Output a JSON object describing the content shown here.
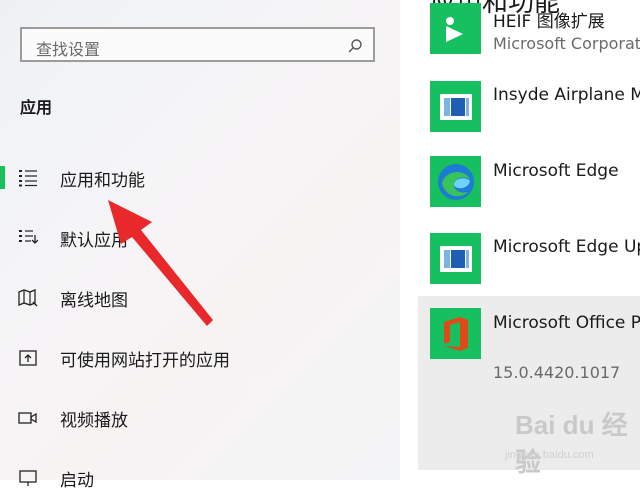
{
  "search": {
    "placeholder": "查找设置",
    "icon": "search-icon"
  },
  "section_title": "应用",
  "nav": [
    {
      "label": "应用和功能",
      "icon": "apps-features-icon",
      "selected": true
    },
    {
      "label": "默认应用",
      "icon": "default-apps-icon"
    },
    {
      "label": "离线地图",
      "icon": "offline-maps-icon"
    },
    {
      "label": "可使用网站打开的应用",
      "icon": "apps-for-websites-icon"
    },
    {
      "label": "视频播放",
      "icon": "video-playback-icon"
    },
    {
      "label": "启动",
      "icon": "startup-icon"
    }
  ],
  "apps_header": "应用和功能",
  "apps": [
    {
      "name": "HEIF 图像扩展",
      "publisher": "Microsoft Corporation"
    },
    {
      "name": "Insyde Airplane Mode",
      "publisher": ""
    },
    {
      "name": "Microsoft Edge",
      "publisher": ""
    },
    {
      "name": "Microsoft Edge Update",
      "publisher": ""
    },
    {
      "name": "Microsoft Office Professional",
      "version": "15.0.4420.1017",
      "selected": true
    }
  ],
  "colors": {
    "accent": "#17c25a",
    "tile_green": "#16c060",
    "office_orange": "#e04a1a",
    "arrow_red": "#e8282a"
  },
  "watermark": {
    "logo": "Bai du 经验",
    "sub": "jingyan.baidu.com"
  }
}
